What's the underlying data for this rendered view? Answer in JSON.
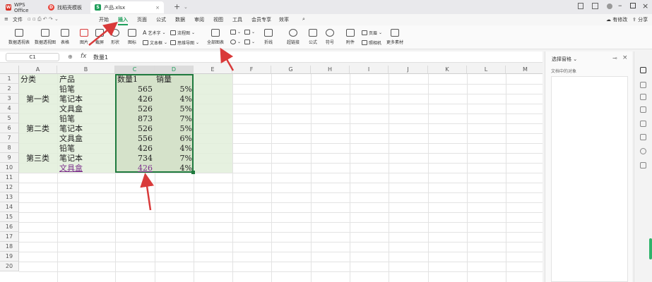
{
  "titlebar": {
    "tabs": [
      {
        "label": "WPS Office",
        "icon": "wps-logo-icon",
        "color": "#d93025"
      },
      {
        "label": "找稻壳模板",
        "icon": "docer-icon",
        "color": "#e8453c"
      },
      {
        "label": "产品.xlsx",
        "icon": "sheet-icon",
        "color": "#1e9e5a"
      }
    ],
    "new_tab": "+"
  },
  "menubar": {
    "file": "文件",
    "items": [
      "开始",
      "插入",
      "页面",
      "公式",
      "数据",
      "审阅",
      "视图",
      "工具",
      "会员专享",
      "效率"
    ],
    "active": "插入",
    "right": [
      "有修改",
      "分享"
    ]
  },
  "ribbon": {
    "buttons": [
      "数据透视表",
      "数据透视图",
      "表格",
      "图片",
      "截屏",
      "形状",
      "图标",
      "全部图表",
      "流程图",
      "超链接",
      "公式",
      "附件",
      "照相机",
      "更多素材"
    ],
    "small_buttons": [
      "艺术字",
      "文本框",
      "流程图",
      "思维导图",
      "折线",
      "符号",
      "页眉",
      "页脚"
    ]
  },
  "formulabar": {
    "name_box": "C1",
    "fx": "fx",
    "content": "数量1"
  },
  "grid": {
    "columns": [
      "A",
      "B",
      "C",
      "D",
      "E",
      "F",
      "G",
      "H",
      "I",
      "J",
      "K",
      "L",
      "M"
    ],
    "rows": [
      "1",
      "2",
      "3",
      "4",
      "5",
      "6",
      "7",
      "8",
      "9",
      "10",
      "11",
      "12",
      "13",
      "14",
      "15",
      "16",
      "17",
      "18",
      "19",
      "20"
    ],
    "headers": [
      "分类",
      "产品",
      "数量1",
      "销量"
    ],
    "categories": [
      "第一类",
      "第二类",
      "第三类"
    ],
    "data": [
      {
        "product": "铅笔",
        "qty": "565",
        "sales": "5%"
      },
      {
        "product": "笔记本",
        "qty": "426",
        "sales": "4%"
      },
      {
        "product": "文具盒",
        "qty": "526",
        "sales": "5%"
      },
      {
        "product": "铅笔",
        "qty": "873",
        "sales": "7%"
      },
      {
        "product": "笔记本",
        "qty": "526",
        "sales": "5%"
      },
      {
        "product": "文具盒",
        "qty": "556",
        "sales": "6%"
      },
      {
        "product": "铅笔",
        "qty": "426",
        "sales": "4%"
      },
      {
        "product": "笔记本",
        "qty": "734",
        "sales": "7%"
      },
      {
        "product": "文具盒",
        "qty": "426",
        "sales": "4%"
      }
    ]
  },
  "rightpanel": {
    "title": "选择窗格",
    "subtitle": "文档中的对象"
  },
  "colors": {
    "accent": "#1e9e5a",
    "table_fill": "#e2efda",
    "selection_fill": "#d7e4cc",
    "arrow": "#d93a3a"
  }
}
